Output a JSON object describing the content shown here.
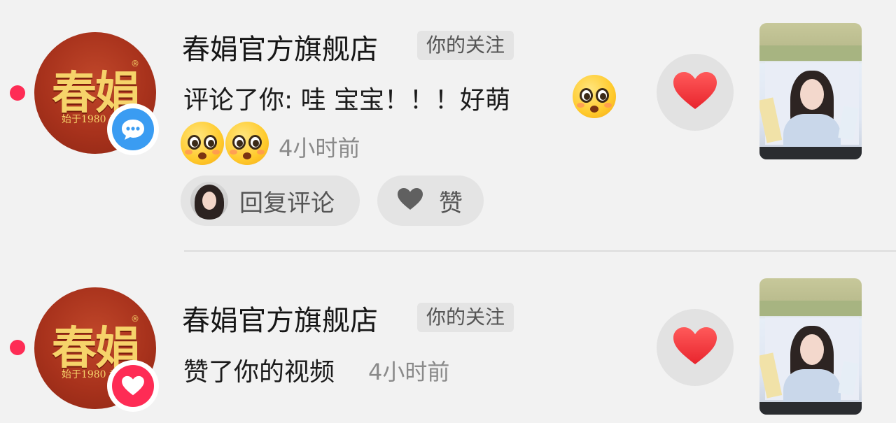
{
  "notifications": [
    {
      "avatar": {
        "brand": "春娟",
        "slogan": "始于1980 专注",
        "mark": "®"
      },
      "badge_icon": "chat-bubble-icon",
      "name": "春娟官方旗舰店",
      "follow_tag": "你的关注",
      "action_text": "评论了你: 哇 宝宝！！！好萌",
      "emojis": [
        "pleading-face-emoji",
        "pleading-face-emoji",
        "pleading-face-emoji"
      ],
      "time": "4小时前",
      "reply_label": "回复评论",
      "like_label": "赞",
      "like_icon": "heart-icon",
      "thumbnail_icon": "video-thumbnail"
    },
    {
      "avatar": {
        "brand": "春娟",
        "slogan": "始于1980 专注",
        "mark": "®"
      },
      "badge_icon": "heart-icon",
      "name": "春娟官方旗舰店",
      "follow_tag": "你的关注",
      "action_text": "赞了你的视频",
      "time": "4小时前",
      "like_icon": "heart-icon",
      "thumbnail_icon": "video-thumbnail"
    }
  ],
  "colors": {
    "accent_red": "#fe2c55",
    "badge_blue": "#3a9cf2",
    "heart_red": "#f23a3e",
    "pill_bg": "#e4e4e4",
    "page_bg": "#f2f2f2"
  }
}
